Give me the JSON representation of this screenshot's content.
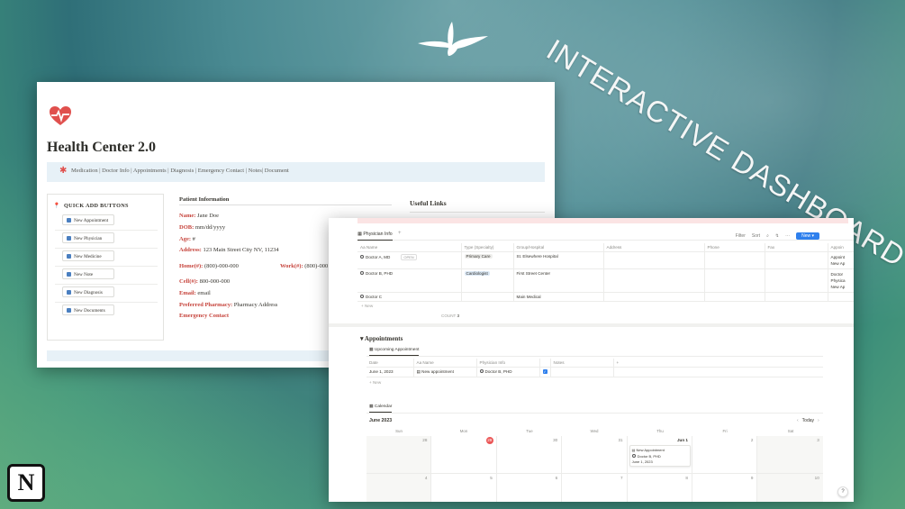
{
  "promo": {
    "title": "INTERACTIVE DASHBOARD",
    "logo_letter": "N"
  },
  "left_window": {
    "page_title": "Health Center 2.0",
    "nav_links": "Medication | Doctor Info | Appointments | Diagnosis | Emergency Contact | Notes| Document",
    "quick_add": {
      "heading": "QUICK ADD BUTTONS",
      "buttons": [
        "New Appointment",
        "New Physician",
        "New Medicine",
        "New Note",
        "New Diagnosis",
        "New Documents"
      ]
    },
    "patient_info": {
      "heading": "Patient Information",
      "name_label": "Name:",
      "name_value": "Jane Doe",
      "dob_label": "DOB:",
      "dob_value": "mm/dd/yyyy",
      "age_label": "Age:",
      "age_value": "#",
      "address_label": "Address:",
      "address_value": "123 Main Street City NV, 11234",
      "home_label": "Home(#):",
      "home_value": "(800)-000-000",
      "work_label": "Work(#):",
      "work_value": "(800)-000",
      "cell_label": "Cell(#):",
      "cell_value": "800-000-000",
      "email_label": "Email:",
      "email_value": "email",
      "pharmacy_label": "Preferred Pharmacy:",
      "pharmacy_value": "Pharmacy Address",
      "emergency_label": "Emergency Contact"
    },
    "useful_links_heading": "Useful Links"
  },
  "right_window": {
    "tab_label": "Physician Info",
    "toolbar": {
      "filter": "Filter",
      "sort": "Sort",
      "new": "New"
    },
    "physician_table": {
      "columns": [
        "Aa Name",
        "Type (Specialty)",
        "Group/Hospital",
        "Address",
        "Phone",
        "Fax",
        "Appoin"
      ],
      "rows": [
        {
          "name": "Doctor A, MD",
          "open": "OPEN",
          "type": "Primary Care",
          "group": "St. Elsewhere Hospital",
          "appts": [
            "Appoint",
            "New Ap"
          ]
        },
        {
          "name": "Doctor B, PHD",
          "open": "",
          "type": "Cardiologist",
          "group": "First Street Center",
          "appts": [
            "Doctor",
            "Physica",
            "New Ap"
          ]
        },
        {
          "name": "Doctor C",
          "open": "",
          "type": "",
          "group": "Main Medical",
          "appts": []
        }
      ],
      "new_row": "+ New",
      "count_label": "COUNT",
      "count_value": "3"
    },
    "appointments": {
      "heading": "Appointments",
      "sub_tab": "Upcoming Appointment",
      "columns": [
        "Date",
        "Aa Name",
        "Physician Info",
        "",
        "Notes",
        "+"
      ],
      "rows": [
        {
          "date": "June 1, 2023",
          "name": "New appointment",
          "physician": "Doctor B, PHD",
          "checked": "✓",
          "notes": ""
        }
      ],
      "new_row": "+ New"
    },
    "calendar": {
      "tab": "Calendar",
      "month": "June 2023",
      "today_button": "Today",
      "days": [
        "Sun",
        "Mon",
        "Tue",
        "Wed",
        "Thu",
        "Fri",
        "Sat"
      ],
      "week1": [
        "28",
        "29",
        "30",
        "31",
        "Jun 1",
        "2",
        "3"
      ],
      "week2": [
        "4",
        "5",
        "6",
        "7",
        "8",
        "9",
        "10"
      ],
      "event": {
        "title": "New Appointment",
        "physician": "Doctor B, PHD",
        "date": "June 1, 2023"
      }
    },
    "help": "?"
  },
  "colors": {
    "accent_red": "#c6433b",
    "notion_blue": "#2f80ed",
    "today_red": "#eb5757"
  }
}
